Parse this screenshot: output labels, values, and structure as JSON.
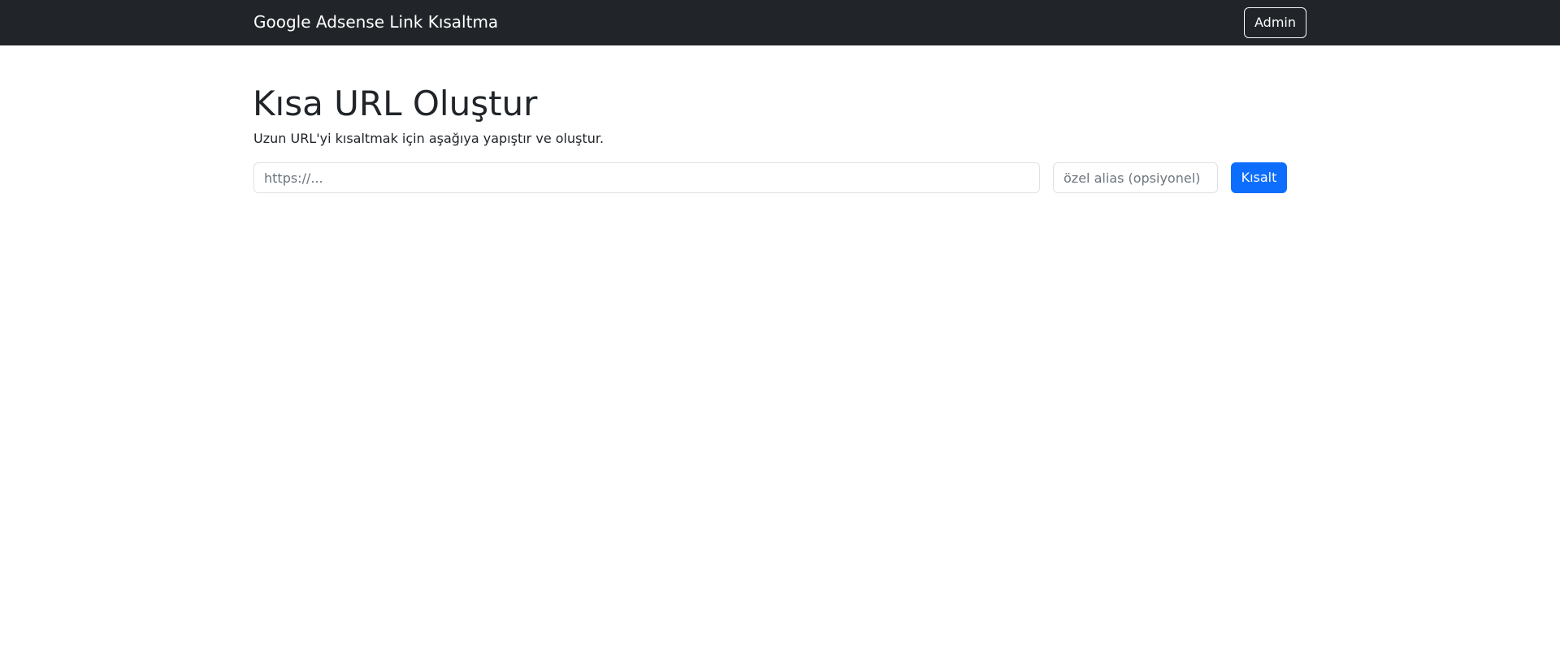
{
  "navbar": {
    "brand": "Google Adsense Link Kısaltma",
    "admin_label": "Admin"
  },
  "main": {
    "title": "Kısa URL Oluştur",
    "subtitle": "Uzun URL'yi kısaltmak için aşağıya yapıştır ve oluştur.",
    "form": {
      "url_placeholder": "https://...",
      "url_value": "",
      "alias_placeholder": "özel alias (opsiyonel)",
      "alias_value": "",
      "submit_label": "Kısalt"
    }
  },
  "colors": {
    "navbar_bg": "#212529",
    "primary": "#0d6efd",
    "text": "#212529",
    "border": "#dee2e6"
  }
}
